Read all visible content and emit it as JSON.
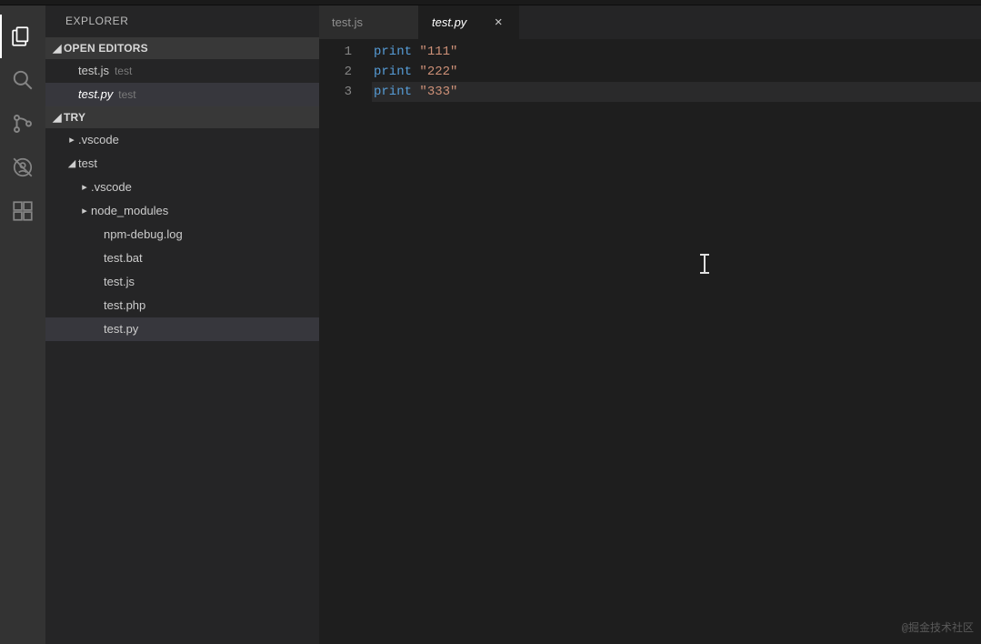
{
  "sidebar": {
    "title": "EXPLORER",
    "sections": {
      "open_editors_label": "OPEN EDITORS",
      "folder_label": "TRY"
    },
    "open_editors": [
      {
        "name": "test.js",
        "path": "test",
        "active": false
      },
      {
        "name": "test.py",
        "path": "test",
        "active": true
      }
    ],
    "tree": [
      {
        "label": ".vscode",
        "depth": 0,
        "folder": true,
        "expanded": false,
        "active": false
      },
      {
        "label": "test",
        "depth": 0,
        "folder": true,
        "expanded": true,
        "active": false
      },
      {
        "label": ".vscode",
        "depth": 1,
        "folder": true,
        "expanded": false,
        "active": false
      },
      {
        "label": "node_modules",
        "depth": 1,
        "folder": true,
        "expanded": false,
        "active": false
      },
      {
        "label": "npm-debug.log",
        "depth": 2,
        "folder": false,
        "expanded": false,
        "active": false
      },
      {
        "label": "test.bat",
        "depth": 2,
        "folder": false,
        "expanded": false,
        "active": false
      },
      {
        "label": "test.js",
        "depth": 2,
        "folder": false,
        "expanded": false,
        "active": false
      },
      {
        "label": "test.php",
        "depth": 2,
        "folder": false,
        "expanded": false,
        "active": false
      },
      {
        "label": "test.py",
        "depth": 2,
        "folder": false,
        "expanded": false,
        "active": true
      }
    ]
  },
  "tabs": [
    {
      "label": "test.js",
      "active": false
    },
    {
      "label": "test.py",
      "active": true
    }
  ],
  "editor": {
    "lines": [
      {
        "num": "1",
        "kw": "print",
        "sp": " ",
        "str": "\"111\"",
        "current": false
      },
      {
        "num": "2",
        "kw": "print",
        "sp": " ",
        "str": "\"222\"",
        "current": false
      },
      {
        "num": "3",
        "kw": "print",
        "sp": " ",
        "str": "\"333\"",
        "current": true
      }
    ]
  },
  "activity": {
    "explorer": "explorer-icon",
    "search": "search-icon",
    "git": "git-icon",
    "debug": "debug-icon",
    "extensions": "extensions-icon"
  },
  "watermark": "@掘金技术社区"
}
